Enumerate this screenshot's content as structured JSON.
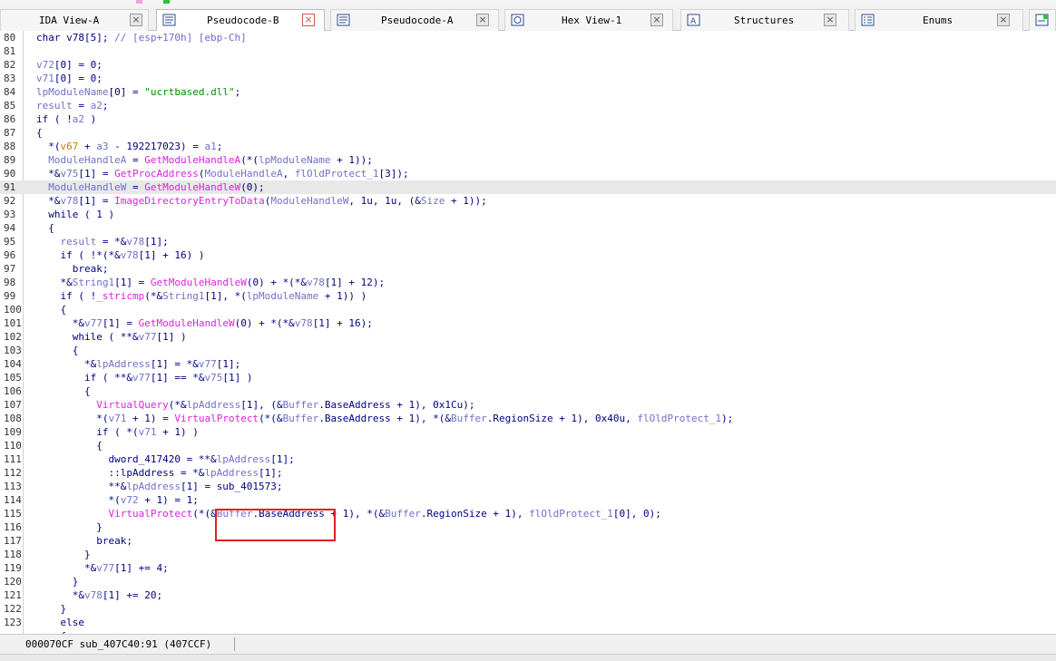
{
  "tabs": [
    {
      "label": "IDA View-A",
      "icon": "ida-view-icon",
      "active": false
    },
    {
      "label": "Pseudocode-B",
      "icon": "pseudocode-icon",
      "active": true
    },
    {
      "label": "Pseudocode-A",
      "icon": "pseudocode-icon",
      "active": false
    },
    {
      "label": "Hex View-1",
      "icon": "hex-view-icon",
      "active": false
    },
    {
      "label": "Structures",
      "icon": "structures-icon",
      "active": false
    },
    {
      "label": "Enums",
      "icon": "enums-icon",
      "active": false
    }
  ],
  "close_glyph": "×",
  "highlighted_line": 91,
  "code_lines": [
    {
      "n": "80",
      "t": [
        [
          "k",
          "char v78[5]; "
        ],
        [
          "c",
          "// [esp+170h] [ebp-Ch]"
        ]
      ]
    },
    {
      "n": "81",
      "t": []
    },
    {
      "n": "82",
      "t": [
        [
          "v",
          "v72"
        ],
        [
          "k",
          "[0] = 0;"
        ]
      ]
    },
    {
      "n": "83",
      "t": [
        [
          "v",
          "v71"
        ],
        [
          "k",
          "[0] = 0;"
        ]
      ]
    },
    {
      "n": "84",
      "t": [
        [
          "v",
          "lpModuleName"
        ],
        [
          "k",
          "[0] = "
        ],
        [
          "s",
          "\"ucrtbased.dll\""
        ],
        [
          "k",
          ";"
        ]
      ]
    },
    {
      "n": "85",
      "t": [
        [
          "v",
          "result"
        ],
        [
          "k",
          " = "
        ],
        [
          "v",
          "a2"
        ],
        [
          "k",
          ";"
        ]
      ]
    },
    {
      "n": "86",
      "t": [
        [
          "k",
          "if ( !"
        ],
        [
          "v",
          "a2"
        ],
        [
          "k",
          " )"
        ]
      ]
    },
    {
      "n": "87",
      "t": [
        [
          "k",
          "{"
        ]
      ]
    },
    {
      "n": "88",
      "t": [
        [
          "k",
          "  *("
        ],
        [
          "o",
          "v67"
        ],
        [
          "k",
          " + "
        ],
        [
          "v",
          "a3"
        ],
        [
          "k",
          " - 192217023) = "
        ],
        [
          "v",
          "a1"
        ],
        [
          "k",
          ";"
        ]
      ]
    },
    {
      "n": "89",
      "t": [
        [
          "k",
          "  "
        ],
        [
          "v",
          "ModuleHandleA"
        ],
        [
          "k",
          " = "
        ],
        [
          "f",
          "GetModuleHandleA"
        ],
        [
          "k",
          "(*("
        ],
        [
          "v",
          "lpModuleName"
        ],
        [
          "k",
          " + 1));"
        ]
      ]
    },
    {
      "n": "90",
      "t": [
        [
          "k",
          "  *&"
        ],
        [
          "v",
          "v75"
        ],
        [
          "k",
          "[1] = "
        ],
        [
          "f",
          "GetProcAddress"
        ],
        [
          "k",
          "("
        ],
        [
          "v",
          "ModuleHandleA"
        ],
        [
          "k",
          ", "
        ],
        [
          "v",
          "flOldProtect_1"
        ],
        [
          "k",
          "[3]);"
        ]
      ]
    },
    {
      "n": "91",
      "t": [
        [
          "k",
          "  "
        ],
        [
          "v",
          "ModuleHandleW"
        ],
        [
          "k",
          " = "
        ],
        [
          "f",
          "GetModuleHandleW"
        ],
        [
          "k",
          "(0);"
        ]
      ]
    },
    {
      "n": "92",
      "t": [
        [
          "k",
          "  *&"
        ],
        [
          "v",
          "v78"
        ],
        [
          "k",
          "[1] = "
        ],
        [
          "f",
          "ImageDirectoryEntryToData"
        ],
        [
          "k",
          "("
        ],
        [
          "v",
          "ModuleHandleW"
        ],
        [
          "k",
          ", 1u, 1u, (&"
        ],
        [
          "v",
          "Size"
        ],
        [
          "k",
          " + 1));"
        ]
      ]
    },
    {
      "n": "93",
      "t": [
        [
          "k",
          "  while ( 1 )"
        ]
      ]
    },
    {
      "n": "94",
      "t": [
        [
          "k",
          "  {"
        ]
      ]
    },
    {
      "n": "95",
      "t": [
        [
          "k",
          "    "
        ],
        [
          "v",
          "result"
        ],
        [
          "k",
          " = *&"
        ],
        [
          "v",
          "v78"
        ],
        [
          "k",
          "[1];"
        ]
      ]
    },
    {
      "n": "96",
      "t": [
        [
          "k",
          "    if ( !*(*&"
        ],
        [
          "v",
          "v78"
        ],
        [
          "k",
          "[1] + 16) )"
        ]
      ]
    },
    {
      "n": "97",
      "t": [
        [
          "k",
          "      break;"
        ]
      ]
    },
    {
      "n": "98",
      "t": [
        [
          "k",
          "    *&"
        ],
        [
          "v",
          "String1"
        ],
        [
          "k",
          "[1] = "
        ],
        [
          "f",
          "GetModuleHandleW"
        ],
        [
          "k",
          "(0) + *(*&"
        ],
        [
          "v",
          "v78"
        ],
        [
          "k",
          "[1] + 12);"
        ]
      ]
    },
    {
      "n": "99",
      "t": [
        [
          "k",
          "    if ( !"
        ],
        [
          "f",
          "_stricmp"
        ],
        [
          "k",
          "(*&"
        ],
        [
          "v",
          "String1"
        ],
        [
          "k",
          "[1], *("
        ],
        [
          "v",
          "lpModuleName"
        ],
        [
          "k",
          " + 1)) )"
        ]
      ]
    },
    {
      "n": "100",
      "t": [
        [
          "k",
          "    {"
        ]
      ]
    },
    {
      "n": "101",
      "t": [
        [
          "k",
          "      *&"
        ],
        [
          "v",
          "v77"
        ],
        [
          "k",
          "[1] = "
        ],
        [
          "f",
          "GetModuleHandleW"
        ],
        [
          "k",
          "(0) + *(*&"
        ],
        [
          "v",
          "v78"
        ],
        [
          "k",
          "[1] + 16);"
        ]
      ]
    },
    {
      "n": "102",
      "t": [
        [
          "k",
          "      while ( **&"
        ],
        [
          "v",
          "v77"
        ],
        [
          "k",
          "[1] )"
        ]
      ]
    },
    {
      "n": "103",
      "t": [
        [
          "k",
          "      {"
        ]
      ]
    },
    {
      "n": "104",
      "t": [
        [
          "k",
          "        *&"
        ],
        [
          "v",
          "lpAddress"
        ],
        [
          "k",
          "[1] = *&"
        ],
        [
          "v",
          "v77"
        ],
        [
          "k",
          "[1];"
        ]
      ]
    },
    {
      "n": "105",
      "t": [
        [
          "k",
          "        if ( **&"
        ],
        [
          "v",
          "v77"
        ],
        [
          "k",
          "[1] == *&"
        ],
        [
          "v",
          "v75"
        ],
        [
          "k",
          "[1] )"
        ]
      ]
    },
    {
      "n": "106",
      "t": [
        [
          "k",
          "        {"
        ]
      ]
    },
    {
      "n": "107",
      "t": [
        [
          "k",
          "          "
        ],
        [
          "f",
          "VirtualQuery"
        ],
        [
          "k",
          "(*&"
        ],
        [
          "v",
          "lpAddress"
        ],
        [
          "k",
          "[1], (&"
        ],
        [
          "v",
          "Buffer"
        ],
        [
          "k",
          ".BaseAddress + 1), 0x1Cu);"
        ]
      ]
    },
    {
      "n": "108",
      "t": [
        [
          "k",
          "          *("
        ],
        [
          "v",
          "v71"
        ],
        [
          "k",
          " + 1) = "
        ],
        [
          "f",
          "VirtualProtect"
        ],
        [
          "k",
          "(*(&"
        ],
        [
          "v",
          "Buffer"
        ],
        [
          "k",
          ".BaseAddress + 1), *(&"
        ],
        [
          "v",
          "Buffer"
        ],
        [
          "k",
          ".RegionSize + 1), 0x40u, "
        ],
        [
          "v",
          "flOldProtect_1"
        ],
        [
          "k",
          ");"
        ]
      ]
    },
    {
      "n": "109",
      "t": [
        [
          "k",
          "          if ( *("
        ],
        [
          "v",
          "v71"
        ],
        [
          "k",
          " + 1) )"
        ]
      ]
    },
    {
      "n": "110",
      "t": [
        [
          "k",
          "          {"
        ]
      ]
    },
    {
      "n": "111",
      "t": [
        [
          "k",
          "            dword_417420 = **&"
        ],
        [
          "v",
          "lpAddress"
        ],
        [
          "k",
          "[1];"
        ]
      ]
    },
    {
      "n": "112",
      "t": [
        [
          "k",
          "            ::lpAddress = *&"
        ],
        [
          "v",
          "lpAddress"
        ],
        [
          "k",
          "[1];"
        ]
      ]
    },
    {
      "n": "113",
      "t": [
        [
          "k",
          "            **&"
        ],
        [
          "v",
          "lpAddress"
        ],
        [
          "k",
          "[1] = sub_401573;"
        ]
      ]
    },
    {
      "n": "114",
      "t": [
        [
          "k",
          "            *("
        ],
        [
          "v",
          "v72"
        ],
        [
          "k",
          " + 1) = 1;"
        ]
      ]
    },
    {
      "n": "115",
      "t": [
        [
          "k",
          "            "
        ],
        [
          "f",
          "VirtualProtect"
        ],
        [
          "k",
          "(*(&"
        ],
        [
          "v",
          "Buffer"
        ],
        [
          "k",
          ".BaseAddress + 1), *(&"
        ],
        [
          "v",
          "Buffer"
        ],
        [
          "k",
          ".RegionSize + 1), "
        ],
        [
          "v",
          "flOldProtect_1"
        ],
        [
          "k",
          "[0], 0);"
        ]
      ]
    },
    {
      "n": "116",
      "t": [
        [
          "k",
          "          }"
        ]
      ]
    },
    {
      "n": "117",
      "t": [
        [
          "k",
          "          break;"
        ]
      ]
    },
    {
      "n": "118",
      "t": [
        [
          "k",
          "        }"
        ]
      ]
    },
    {
      "n": "119",
      "t": [
        [
          "k",
          "        *&"
        ],
        [
          "v",
          "v77"
        ],
        [
          "k",
          "[1] += 4;"
        ]
      ]
    },
    {
      "n": "120",
      "t": [
        [
          "k",
          "      }"
        ]
      ]
    },
    {
      "n": "121",
      "t": [
        [
          "k",
          "      *&"
        ],
        [
          "v",
          "v78"
        ],
        [
          "k",
          "[1] += 20;"
        ]
      ]
    },
    {
      "n": "122",
      "t": [
        [
          "k",
          "    }"
        ]
      ]
    },
    {
      "n": "123",
      "t": [
        [
          "k",
          "    else"
        ]
      ]
    },
    {
      "n": "",
      "t": [
        [
          "k",
          "    {"
        ]
      ]
    }
  ],
  "status": {
    "text": "000070CF sub_407C40:91 (407CCF)"
  },
  "colors": {
    "keyword": "#000080",
    "function": "#e020e0",
    "string": "#009000",
    "variable": "#7070c8",
    "comment": "#6a6ad0",
    "highlight_box": "#e02020",
    "current_line": "#e8e8e8"
  }
}
